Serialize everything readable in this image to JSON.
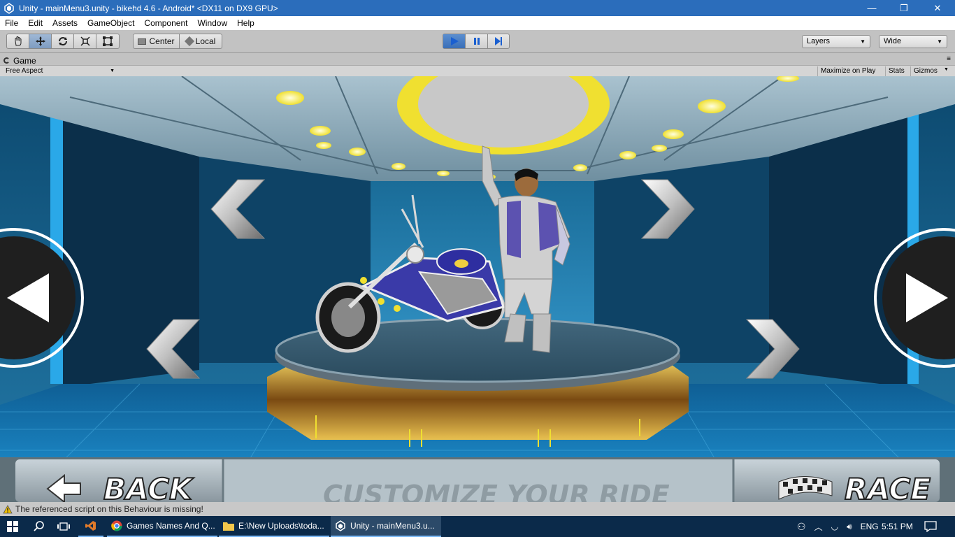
{
  "window": {
    "title": "Unity - mainMenu3.unity - bikehd 4.6 - Android* <DX11 on DX9 GPU>",
    "minimize": "—",
    "maximize": "❐",
    "close": "✕"
  },
  "menu": [
    "File",
    "Edit",
    "Assets",
    "GameObject",
    "Component",
    "Window",
    "Help"
  ],
  "toolbar": {
    "pivot_label": "Center",
    "space_label": "Local",
    "layers_label": "Layers",
    "layout_label": "Wide"
  },
  "game_panel": {
    "tab_label": "Game",
    "aspect_label": "Free Aspect",
    "maximize_label": "Maximize on Play",
    "stats_label": "Stats",
    "gizmos_label": "Gizmos"
  },
  "game_ui": {
    "back_label": "BACK",
    "title_label": "CUSTOMIZE YOUR RIDE",
    "race_label": "RACE"
  },
  "status": {
    "message": "The referenced script on this Behaviour is missing!"
  },
  "taskbar": {
    "tasks": [
      "Games Names And Q...",
      "E:\\New Uploads\\toda...",
      "Unity - mainMenu3.u..."
    ],
    "language": "ENG",
    "time": "5:51 PM"
  },
  "colors": {
    "titlebar": "#2b6dbb",
    "unity_gray": "#c2c2c2",
    "taskbar": "#0b2a4a",
    "gold_ring": "#f0e030",
    "accent_blue": "#2aa8e8"
  }
}
